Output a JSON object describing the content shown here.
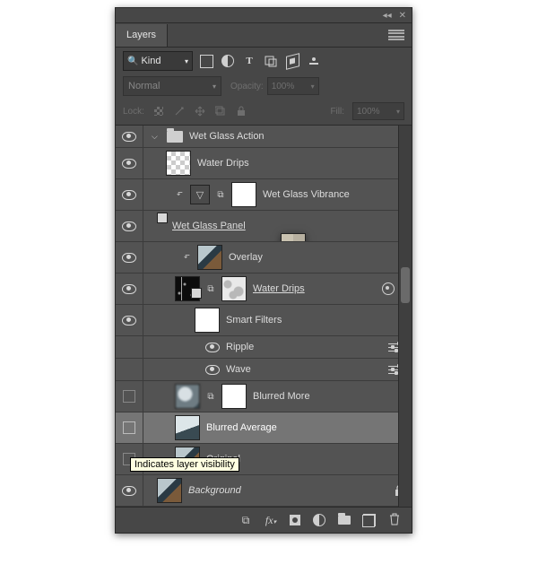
{
  "header": {
    "tab_label": "Layers"
  },
  "filters": {
    "kind_label": "Kind"
  },
  "blend": {
    "mode": "Normal",
    "opacity_label": "Opacity:",
    "opacity_value": "100%"
  },
  "lock": {
    "label": "Lock:",
    "fill_label": "Fill:",
    "fill_value": "100%"
  },
  "tooltip": "Indicates layer visibility",
  "layers": {
    "group": "Wet Glass Action",
    "items": [
      {
        "name": "Water Drips"
      },
      {
        "name": "Wet Glass Vibrance"
      },
      {
        "name": "Wet Glass Panel "
      },
      {
        "name": "Overlay"
      },
      {
        "name": "Water Drips "
      },
      {
        "name": "Smart Filters"
      },
      {
        "name": "Ripple"
      },
      {
        "name": "Wave"
      },
      {
        "name": "Blurred More"
      },
      {
        "name": "Blurred Average"
      },
      {
        "name": "Original"
      },
      {
        "name": "Background"
      }
    ]
  }
}
